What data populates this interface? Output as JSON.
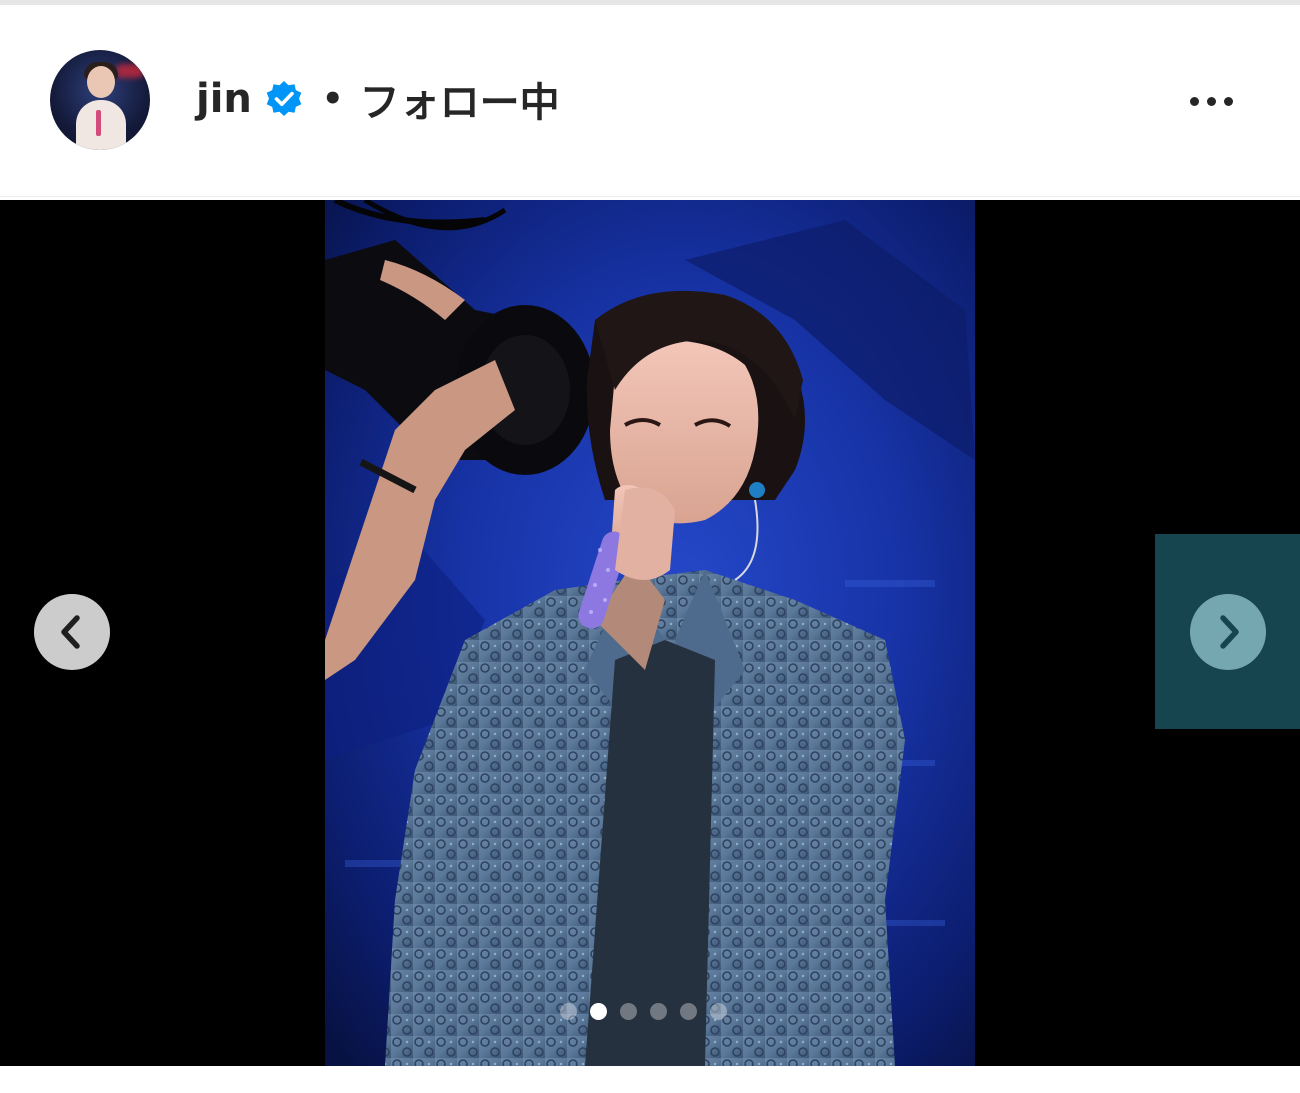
{
  "post": {
    "username": "jin",
    "separator": "•",
    "follow_status": "フォロー中",
    "verified": true,
    "more_options": "•••"
  },
  "icons": {
    "verified": "verified-badge-icon",
    "more": "more-options-icon",
    "prev": "chevron-left-icon",
    "next": "chevron-right-icon"
  },
  "colors": {
    "verified_blue": "#0095f6",
    "text": "#262626",
    "media_background": "#000000",
    "next_panel": "#16444f"
  },
  "carousel": {
    "current_index": 1,
    "total": 6
  }
}
